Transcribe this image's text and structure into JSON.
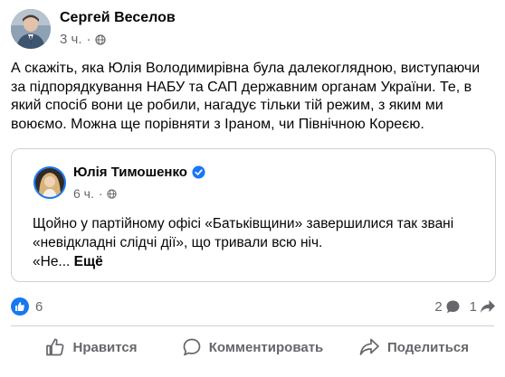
{
  "post": {
    "author": "Сергей Веселов",
    "time": "3 ч.",
    "separator": "·",
    "text": "А скажіть, яка Юлія Володимирівна була далекоглядною, виступаючи за підпорядкування НАБУ та САП державним органам України. Те, в який спосіб вони це робили, нагадує тільки тій режим, з яким ми воюємо. Можна ще порівняти з Іраном, чи Північною Кореєю."
  },
  "shared_post": {
    "author": "Юлія Тимошенко",
    "time": "6 ч.",
    "separator": "·",
    "line1": "Щойно у партійному офісі «Батьківщини» завершилися так звані",
    "line2": "«невідкладні слідчі дії», що тривали всю ніч.",
    "line3": "«Не...",
    "more_label": "Ещё"
  },
  "reactions": {
    "likes": "6",
    "comments": "2",
    "shares": "1"
  },
  "actions": {
    "like": "Нравится",
    "comment": "Комментировать",
    "share": "Поделиться"
  },
  "colors": {
    "accent": "#1877f2",
    "secondary_text": "#65676b",
    "primary_text": "#050505",
    "border": "#ced0d4"
  },
  "icons": {
    "globe": "globe-icon",
    "verified": "verified-badge-icon",
    "like_reaction": "like-reaction-icon",
    "comment": "comment-bubble-icon",
    "share": "share-arrow-icon",
    "like_action": "thumbs-up-icon",
    "comment_action": "comment-icon",
    "share_action": "share-icon"
  }
}
